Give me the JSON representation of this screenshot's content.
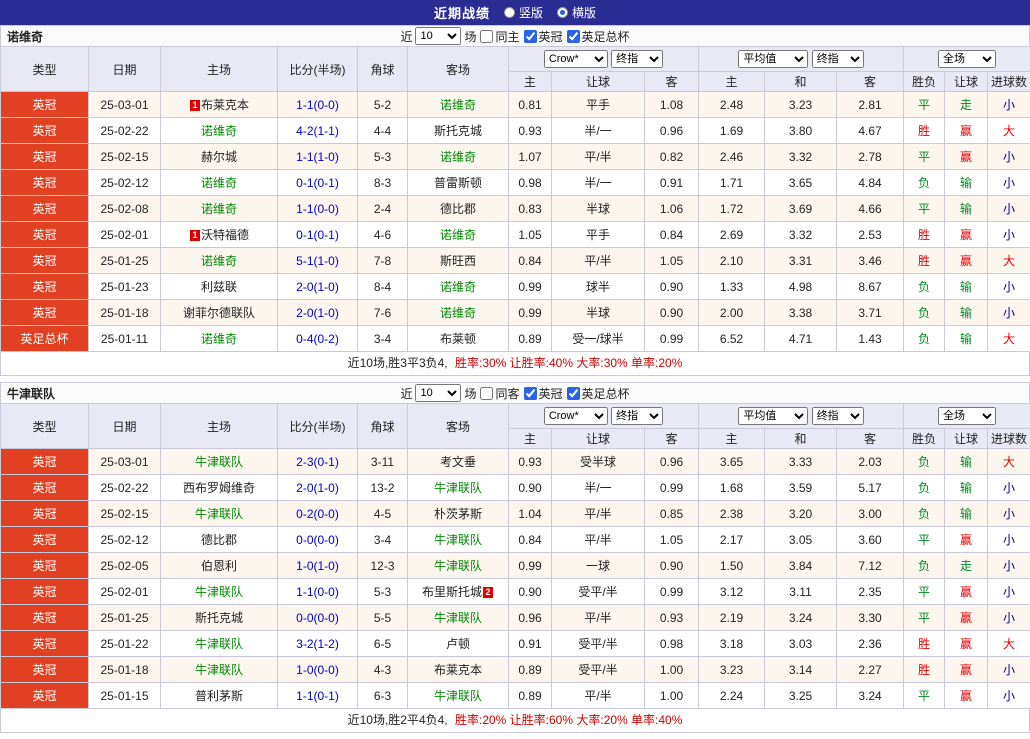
{
  "top_bar": {
    "title": "近期战绩",
    "radios": [
      {
        "label": "竖版",
        "checked": false
      },
      {
        "label": "横版",
        "checked": true
      }
    ]
  },
  "labels": {
    "recent": "近",
    "games": "场",
    "league1": "英冠",
    "league2": "英足总杯"
  },
  "header": {
    "cols": [
      "类型",
      "日期",
      "主场",
      "比分(半场)",
      "角球",
      "客场"
    ],
    "odds_sub": [
      "主",
      "让球",
      "客"
    ],
    "avg_sub": [
      "主",
      "和",
      "客"
    ],
    "result_sub": [
      "胜负",
      "让球",
      "进球数"
    ],
    "selects": {
      "company": "Crow*",
      "final1": "终指",
      "average": "平均值",
      "final2": "终指",
      "scope": "全场"
    }
  },
  "colors": {
    "topbar_bg": "#2b2b94",
    "header_bg": "#e9e9f5",
    "type_bg": "#e24023",
    "self_team": "#008800",
    "score_blue": "#0000cc",
    "summary_red": "#cc0000",
    "card_bg": "#e00000",
    "result_map": {
      "胜": "#e60000",
      "赢": "#e60000",
      "大": "#e60000",
      "平": "#008822",
      "负": "#008822",
      "走": "#008822",
      "输": "#008822",
      "小": "#000080"
    }
  },
  "tables": [
    {
      "team": "诺维奇",
      "filter": {
        "count": "10",
        "same_label": "同主",
        "same_checked": false,
        "league_checked": true,
        "cup_checked": true
      },
      "rows": [
        {
          "type": "英冠",
          "date": "25-03-01",
          "home": {
            "name": "布莱克本",
            "self": false,
            "card": "1",
            "card_pos": "l"
          },
          "score": "1-1(0-0)",
          "corner": "5-2",
          "away": {
            "name": "诺维奇",
            "self": true
          },
          "odds": [
            "0.81",
            "平手",
            "1.08"
          ],
          "avg": [
            "2.48",
            "3.23",
            "2.81"
          ],
          "result": [
            "平",
            "走",
            "小"
          ]
        },
        {
          "type": "英冠",
          "date": "25-02-22",
          "home": {
            "name": "诺维奇",
            "self": true
          },
          "score": "4-2(1-1)",
          "corner": "4-4",
          "away": {
            "name": "斯托克城",
            "self": false
          },
          "odds": [
            "0.93",
            "半/一",
            "0.96"
          ],
          "avg": [
            "1.69",
            "3.80",
            "4.67"
          ],
          "result": [
            "胜",
            "赢",
            "大"
          ]
        },
        {
          "type": "英冠",
          "date": "25-02-15",
          "home": {
            "name": "赫尔城",
            "self": false
          },
          "score": "1-1(1-0)",
          "corner": "5-3",
          "away": {
            "name": "诺维奇",
            "self": true
          },
          "odds": [
            "1.07",
            "平/半",
            "0.82"
          ],
          "avg": [
            "2.46",
            "3.32",
            "2.78"
          ],
          "result": [
            "平",
            "赢",
            "小"
          ]
        },
        {
          "type": "英冠",
          "date": "25-02-12",
          "home": {
            "name": "诺维奇",
            "self": true
          },
          "score": "0-1(0-1)",
          "corner": "8-3",
          "away": {
            "name": "普雷斯顿",
            "self": false
          },
          "odds": [
            "0.98",
            "半/一",
            "0.91"
          ],
          "avg": [
            "1.71",
            "3.65",
            "4.84"
          ],
          "result": [
            "负",
            "输",
            "小"
          ]
        },
        {
          "type": "英冠",
          "date": "25-02-08",
          "home": {
            "name": "诺维奇",
            "self": true
          },
          "score": "1-1(0-0)",
          "corner": "2-4",
          "away": {
            "name": "德比郡",
            "self": false
          },
          "odds": [
            "0.83",
            "半球",
            "1.06"
          ],
          "avg": [
            "1.72",
            "3.69",
            "4.66"
          ],
          "result": [
            "平",
            "输",
            "小"
          ]
        },
        {
          "type": "英冠",
          "date": "25-02-01",
          "home": {
            "name": "沃特福德",
            "self": false,
            "card": "1",
            "card_pos": "l"
          },
          "score": "0-1(0-1)",
          "corner": "4-6",
          "away": {
            "name": "诺维奇",
            "self": true
          },
          "odds": [
            "1.05",
            "平手",
            "0.84"
          ],
          "avg": [
            "2.69",
            "3.32",
            "2.53"
          ],
          "result": [
            "胜",
            "赢",
            "小"
          ]
        },
        {
          "type": "英冠",
          "date": "25-01-25",
          "home": {
            "name": "诺维奇",
            "self": true
          },
          "score": "5-1(1-0)",
          "corner": "7-8",
          "away": {
            "name": "斯旺西",
            "self": false
          },
          "odds": [
            "0.84",
            "平/半",
            "1.05"
          ],
          "avg": [
            "2.10",
            "3.31",
            "3.46"
          ],
          "result": [
            "胜",
            "赢",
            "大"
          ]
        },
        {
          "type": "英冠",
          "date": "25-01-23",
          "home": {
            "name": "利兹联",
            "self": false
          },
          "score": "2-0(1-0)",
          "corner": "8-4",
          "away": {
            "name": "诺维奇",
            "self": true
          },
          "odds": [
            "0.99",
            "球半",
            "0.90"
          ],
          "avg": [
            "1.33",
            "4.98",
            "8.67"
          ],
          "result": [
            "负",
            "输",
            "小"
          ]
        },
        {
          "type": "英冠",
          "date": "25-01-18",
          "home": {
            "name": "谢菲尔德联队",
            "self": false
          },
          "score": "2-0(1-0)",
          "corner": "7-6",
          "away": {
            "name": "诺维奇",
            "self": true
          },
          "odds": [
            "0.99",
            "半球",
            "0.90"
          ],
          "avg": [
            "2.00",
            "3.38",
            "3.71"
          ],
          "result": [
            "负",
            "输",
            "小"
          ]
        },
        {
          "type": "英足总杯",
          "date": "25-01-11",
          "home": {
            "name": "诺维奇",
            "self": true
          },
          "score": "0-4(0-2)",
          "corner": "3-4",
          "away": {
            "name": "布莱顿",
            "self": false
          },
          "odds": [
            "0.89",
            "受一/球半",
            "0.99"
          ],
          "avg": [
            "6.52",
            "4.71",
            "1.43"
          ],
          "result": [
            "负",
            "输",
            "大"
          ]
        }
      ],
      "summary": {
        "record": "近10场,胜3平3负4,",
        "rates": "胜率:30% 让胜率:40% 大率:30% 单率:20%"
      }
    },
    {
      "team": "牛津联队",
      "filter": {
        "count": "10",
        "same_label": "同客",
        "same_checked": false,
        "league_checked": true,
        "cup_checked": true
      },
      "rows": [
        {
          "type": "英冠",
          "date": "25-03-01",
          "home": {
            "name": "牛津联队",
            "self": true
          },
          "score": "2-3(0-1)",
          "corner": "3-11",
          "away": {
            "name": "考文垂",
            "self": false
          },
          "odds": [
            "0.93",
            "受半球",
            "0.96"
          ],
          "avg": [
            "3.65",
            "3.33",
            "2.03"
          ],
          "result": [
            "负",
            "输",
            "大"
          ]
        },
        {
          "type": "英冠",
          "date": "25-02-22",
          "home": {
            "name": "西布罗姆维奇",
            "self": false
          },
          "score": "2-0(1-0)",
          "corner": "13-2",
          "away": {
            "name": "牛津联队",
            "self": true
          },
          "odds": [
            "0.90",
            "半/一",
            "0.99"
          ],
          "avg": [
            "1.68",
            "3.59",
            "5.17"
          ],
          "result": [
            "负",
            "输",
            "小"
          ]
        },
        {
          "type": "英冠",
          "date": "25-02-15",
          "home": {
            "name": "牛津联队",
            "self": true
          },
          "score": "0-2(0-0)",
          "corner": "4-5",
          "away": {
            "name": "朴茨茅斯",
            "self": false
          },
          "odds": [
            "1.04",
            "平/半",
            "0.85"
          ],
          "avg": [
            "2.38",
            "3.20",
            "3.00"
          ],
          "result": [
            "负",
            "输",
            "小"
          ]
        },
        {
          "type": "英冠",
          "date": "25-02-12",
          "home": {
            "name": "德比郡",
            "self": false
          },
          "score": "0-0(0-0)",
          "corner": "3-4",
          "away": {
            "name": "牛津联队",
            "self": true
          },
          "odds": [
            "0.84",
            "平/半",
            "1.05"
          ],
          "avg": [
            "2.17",
            "3.05",
            "3.60"
          ],
          "result": [
            "平",
            "赢",
            "小"
          ]
        },
        {
          "type": "英冠",
          "date": "25-02-05",
          "home": {
            "name": "伯恩利",
            "self": false
          },
          "score": "1-0(1-0)",
          "corner": "12-3",
          "away": {
            "name": "牛津联队",
            "self": true
          },
          "odds": [
            "0.99",
            "一球",
            "0.90"
          ],
          "avg": [
            "1.50",
            "3.84",
            "7.12"
          ],
          "result": [
            "负",
            "走",
            "小"
          ]
        },
        {
          "type": "英冠",
          "date": "25-02-01",
          "home": {
            "name": "牛津联队",
            "self": true
          },
          "score": "1-1(0-0)",
          "corner": "5-3",
          "away": {
            "name": "布里斯托城",
            "self": false,
            "card": "2",
            "card_pos": "r"
          },
          "odds": [
            "0.90",
            "受平/半",
            "0.99"
          ],
          "avg": [
            "3.12",
            "3.11",
            "2.35"
          ],
          "result": [
            "平",
            "赢",
            "小"
          ]
        },
        {
          "type": "英冠",
          "date": "25-01-25",
          "home": {
            "name": "斯托克城",
            "self": false
          },
          "score": "0-0(0-0)",
          "corner": "5-5",
          "away": {
            "name": "牛津联队",
            "self": true
          },
          "odds": [
            "0.96",
            "平/半",
            "0.93"
          ],
          "avg": [
            "2.19",
            "3.24",
            "3.30"
          ],
          "result": [
            "平",
            "赢",
            "小"
          ]
        },
        {
          "type": "英冠",
          "date": "25-01-22",
          "home": {
            "name": "牛津联队",
            "self": true
          },
          "score": "3-2(1-2)",
          "corner": "6-5",
          "away": {
            "name": "卢顿",
            "self": false
          },
          "odds": [
            "0.91",
            "受平/半",
            "0.98"
          ],
          "avg": [
            "3.18",
            "3.03",
            "2.36"
          ],
          "result": [
            "胜",
            "赢",
            "大"
          ]
        },
        {
          "type": "英冠",
          "date": "25-01-18",
          "home": {
            "name": "牛津联队",
            "self": true
          },
          "score": "1-0(0-0)",
          "corner": "4-3",
          "away": {
            "name": "布莱克本",
            "self": false
          },
          "odds": [
            "0.89",
            "受平/半",
            "1.00"
          ],
          "avg": [
            "3.23",
            "3.14",
            "2.27"
          ],
          "result": [
            "胜",
            "赢",
            "小"
          ]
        },
        {
          "type": "英冠",
          "date": "25-01-15",
          "home": {
            "name": "普利茅斯",
            "self": false
          },
          "score": "1-1(0-1)",
          "corner": "6-3",
          "away": {
            "name": "牛津联队",
            "self": true
          },
          "odds": [
            "0.89",
            "平/半",
            "1.00"
          ],
          "avg": [
            "2.24",
            "3.25",
            "3.24"
          ],
          "result": [
            "平",
            "赢",
            "小"
          ]
        }
      ],
      "summary": {
        "record": "近10场,胜2平4负4,",
        "rates": "胜率:20% 让胜率:60% 大率:20% 单率:40%"
      }
    }
  ]
}
